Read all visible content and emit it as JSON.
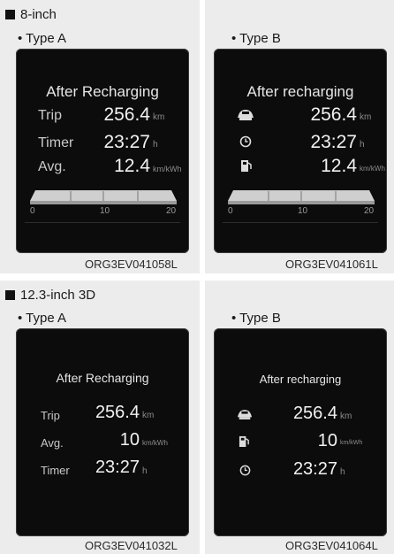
{
  "section1": {
    "title": "8-inch",
    "typeA": {
      "label": "• Type A",
      "heading": "After Recharging",
      "rows": [
        {
          "label": "Trip",
          "value": "256.4",
          "unit": "km"
        },
        {
          "label": "Timer",
          "value": "23:27",
          "unit": "h"
        },
        {
          "label": "Avg.",
          "value": "12.4",
          "unit": "km/kWh"
        }
      ],
      "ticks": [
        "0",
        "10",
        "20"
      ],
      "code": "ORG3EV041058L"
    },
    "typeB": {
      "label": "• Type B",
      "heading": "After recharging",
      "rows": [
        {
          "icon": "car-icon",
          "value": "256.4",
          "unit": "km"
        },
        {
          "icon": "clock-icon",
          "value": "23:27",
          "unit": "h"
        },
        {
          "icon": "fuel-pump-icon",
          "value": "12.4",
          "unit": "km/kWh"
        }
      ],
      "ticks": [
        "0",
        "10",
        "20"
      ],
      "code": "ORG3EV041061L"
    }
  },
  "section2": {
    "title": "12.3-inch 3D",
    "typeA": {
      "label": "• Type A",
      "heading": "After Recharging",
      "rows": [
        {
          "label": "Trip",
          "value": "256.4",
          "unit": "km"
        },
        {
          "label": "Avg.",
          "value": "10",
          "unit": "km/kWh"
        },
        {
          "label": "Timer",
          "value": "23:27",
          "unit": "h"
        }
      ],
      "code": "ORG3EV041032L"
    },
    "typeB": {
      "label": "• Type B",
      "heading": "After recharging",
      "rows": [
        {
          "icon": "car-icon",
          "value": "256.4",
          "unit": "km"
        },
        {
          "icon": "fuel-pump-icon",
          "value": "10",
          "unit": "km/kWh"
        },
        {
          "icon": "clock-icon",
          "value": "23:27",
          "unit": "h"
        }
      ],
      "code": "ORG3EV041064L"
    }
  }
}
